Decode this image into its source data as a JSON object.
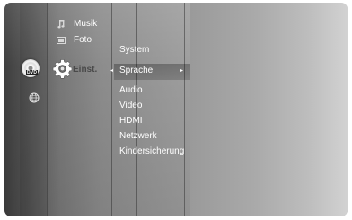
{
  "menu": {
    "music_label": "Musik",
    "photo_label": "Foto",
    "settings_label": "Einst.",
    "disc_badge": "DVD"
  },
  "submenu": {
    "system_label": "System",
    "items": [
      "Sprache",
      "Audio",
      "Video",
      "HDMI",
      "Netzwerk",
      "Kindersicherung"
    ],
    "selected_index": 0
  },
  "icons": {
    "music": "music-note-icon",
    "photo": "photo-icon",
    "settings": "gear-icon",
    "disc": "dvd-disc-icon",
    "network": "globe-icon"
  }
}
